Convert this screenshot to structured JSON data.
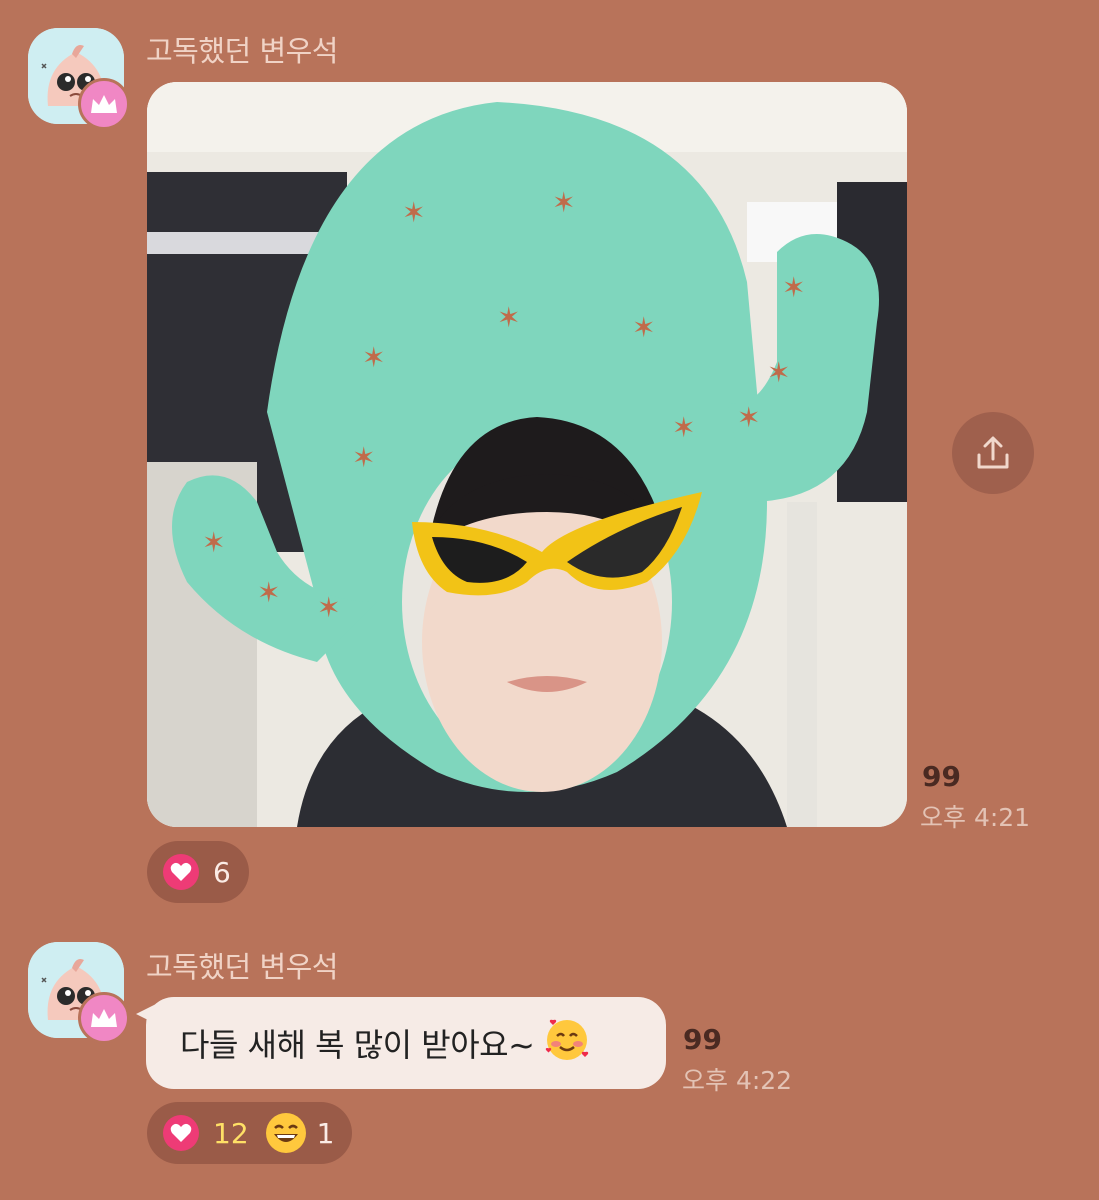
{
  "messages": [
    {
      "sender": "고독했던 변우석",
      "type": "photo",
      "unread_count": "99",
      "time": "오후 4:21",
      "reactions": [
        {
          "icon": "heart-icon",
          "count": "6",
          "color": "#ee3b76"
        }
      ]
    },
    {
      "sender": "고독했던 변우석",
      "type": "text",
      "text": "다들 새해 복 많이 받아요~",
      "unread_count": "99",
      "time": "오후 4:22",
      "reactions": [
        {
          "icon": "heart-icon",
          "count": "12",
          "color": "#ee3b76"
        },
        {
          "icon": "grinning-face-icon",
          "count": "1"
        }
      ]
    }
  ],
  "icons": {
    "share": "share-icon",
    "badge": "crown-icon",
    "message_emoji": "smiling-face-with-hearts-emoji"
  },
  "colors": {
    "background": "#b8735a",
    "bubble": "#f6ebe6",
    "reaction_pill": "#9a5b48",
    "heart": "#ee3b76",
    "badge": "#f087c4"
  }
}
